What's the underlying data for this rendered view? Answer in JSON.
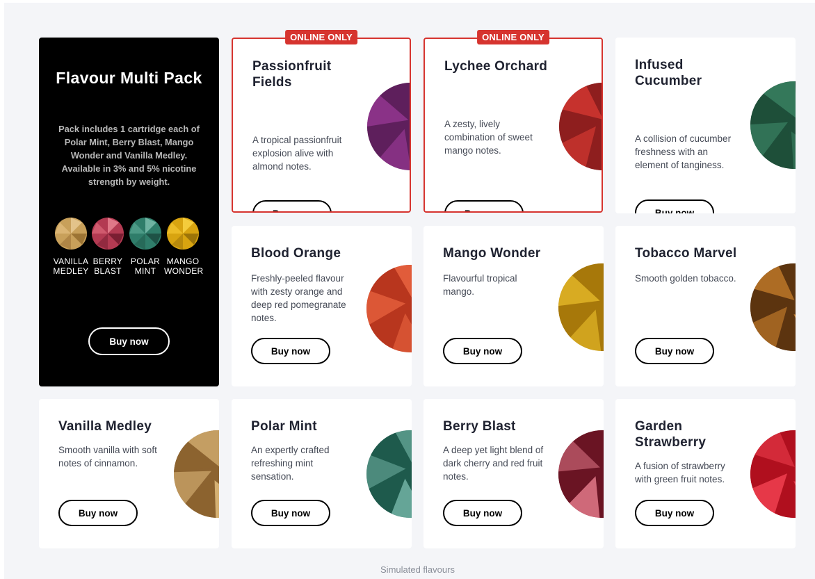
{
  "multi_pack": {
    "title": "Flavour Multi Pack",
    "description": "Pack includes 1 cartridge each of Polar Mint, Berry Blast, Mango Wonder and Vanilla Medley. Available in 3% and 5% nicotine strength by weight.",
    "swatches": [
      {
        "label_line1": "VANILLA",
        "label_line2": "MEDLEY",
        "color": "#c8a05a"
      },
      {
        "label_line1": "BERRY",
        "label_line2": "BLAST",
        "color": "#b33a52"
      },
      {
        "label_line1": "POLAR",
        "label_line2": "MINT",
        "color": "#2f7d6a"
      },
      {
        "label_line1": "MANGO",
        "label_line2": "WONDER",
        "color": "#d8a410"
      }
    ],
    "button": "Buy now"
  },
  "badge_label": "ONLINE ONLY",
  "products": [
    {
      "title": "Passionfruit Fields",
      "description": "A tropical passionfruit explosion alive with almond notes.",
      "button": "Buy now",
      "online_only": true,
      "colors": [
        "#5e1f5c",
        "#9a3a96"
      ]
    },
    {
      "title": "Lychee Orchard",
      "description": "A zesty, lively combination of sweet mango notes.",
      "button": "Buy now",
      "online_only": true,
      "colors": [
        "#8e1e1e",
        "#d83a33"
      ]
    },
    {
      "title": "Infused Cucumber",
      "description": "A collision of cucumber freshness with an element of tanginess.",
      "button": "Buy now",
      "online_only": false,
      "colors": [
        "#1e4f3a",
        "#3c8565"
      ]
    },
    {
      "title": "Blood Orange",
      "description": "Freshly-peeled flavour with zesty orange and deep red pomegranate notes.",
      "button": "Buy now",
      "online_only": false,
      "colors": [
        "#b8361e",
        "#ef6a44"
      ]
    },
    {
      "title": "Mango Wonder",
      "description": "Flavourful tropical mango.",
      "button": "Buy now",
      "online_only": false,
      "colors": [
        "#a7780a",
        "#f2c630"
      ]
    },
    {
      "title": "Tobacco Marvel",
      "description": "Smooth golden tobacco.",
      "button": "Buy now",
      "online_only": false,
      "colors": [
        "#5c3410",
        "#d98b30"
      ]
    },
    {
      "title": "Vanilla Medley",
      "description": "Smooth vanilla with soft notes of cinnamon.",
      "button": "Buy now",
      "online_only": false,
      "colors": [
        "#8c6330",
        "#e2be80"
      ]
    },
    {
      "title": "Polar Mint",
      "description": "An expertly crafted refreshing mint sensation.",
      "button": "Buy now",
      "online_only": false,
      "colors": [
        "#1e5a4c",
        "#72b3a4"
      ]
    },
    {
      "title": "Berry Blast",
      "description": "A deep yet light blend of dark cherry and red fruit notes.",
      "button": "Buy now",
      "online_only": false,
      "colors": [
        "#6a1424",
        "#e07888"
      ]
    },
    {
      "title": "Garden Strawberry",
      "description": "A fusion of strawberry with green fruit notes.",
      "button": "Buy now",
      "online_only": false,
      "colors": [
        "#b0101e",
        "#f04050"
      ]
    }
  ],
  "footnote": "Simulated flavours"
}
